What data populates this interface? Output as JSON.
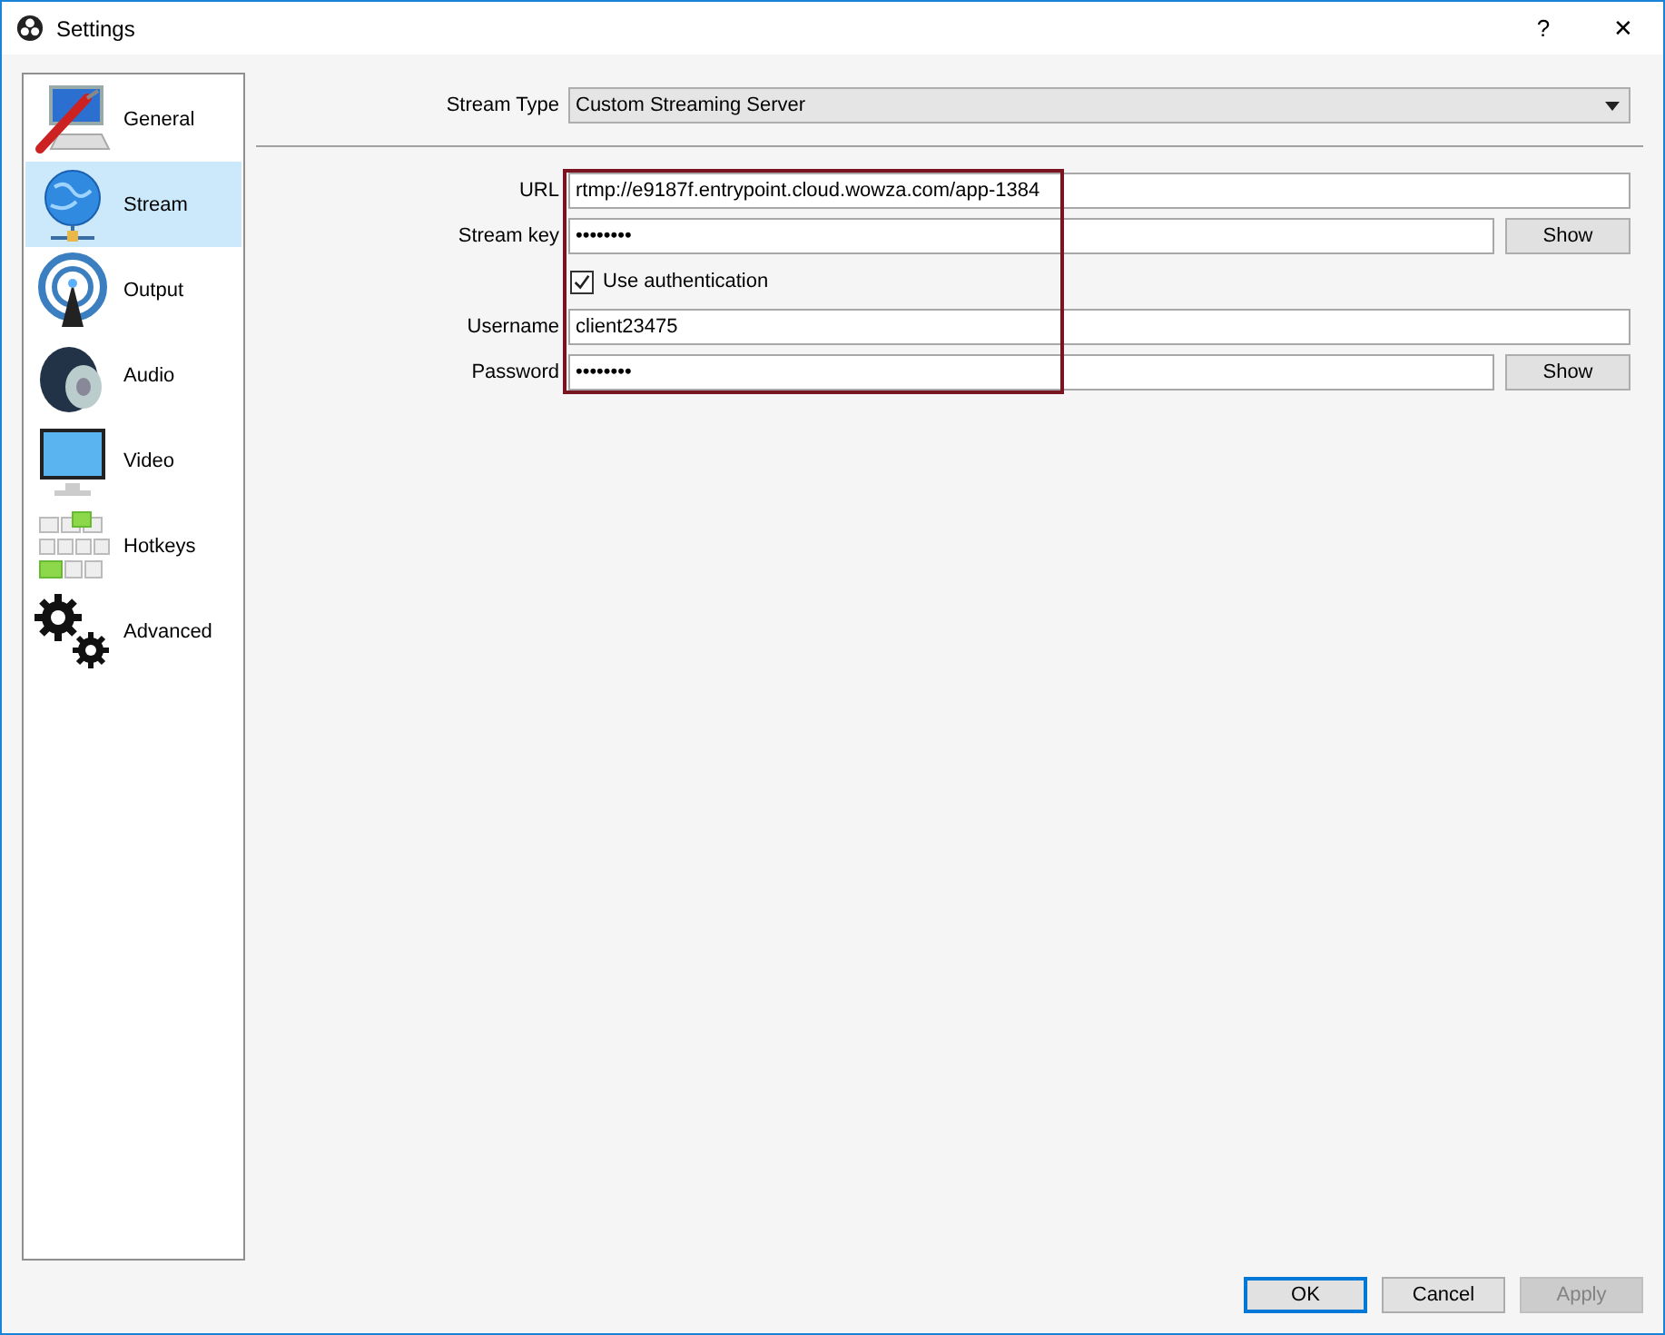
{
  "window": {
    "title": "Settings",
    "help": "?",
    "close": "✕"
  },
  "sidebar": {
    "items": [
      {
        "label": "General",
        "kind": "general",
        "selected": false
      },
      {
        "label": "Stream",
        "kind": "stream",
        "selected": true
      },
      {
        "label": "Output",
        "kind": "output",
        "selected": false
      },
      {
        "label": "Audio",
        "kind": "audio",
        "selected": false
      },
      {
        "label": "Video",
        "kind": "video",
        "selected": false
      },
      {
        "label": "Hotkeys",
        "kind": "hotkeys",
        "selected": false
      },
      {
        "label": "Advanced",
        "kind": "advanced",
        "selected": false
      }
    ]
  },
  "stream_type": {
    "label": "Stream Type",
    "value": "Custom Streaming Server"
  },
  "form": [
    {
      "kind": "field",
      "label": "URL",
      "value": "rtmp://e9187f.entrypoint.cloud.wowza.com/app-1384"
    },
    {
      "kind": "field",
      "label": "Stream key",
      "value": "••••••••",
      "button": "Show"
    },
    {
      "kind": "checkbox",
      "label": "Use authentication",
      "checked": true
    },
    {
      "kind": "field",
      "label": "Username",
      "value": "client23475"
    },
    {
      "kind": "field",
      "label": "Password",
      "value": "••••••••",
      "button": "Show"
    }
  ],
  "buttons": [
    {
      "label": "OK",
      "default": true,
      "disabled": false
    },
    {
      "label": "Cancel",
      "default": false,
      "disabled": false
    },
    {
      "label": "Apply",
      "default": false,
      "disabled": true
    }
  ]
}
